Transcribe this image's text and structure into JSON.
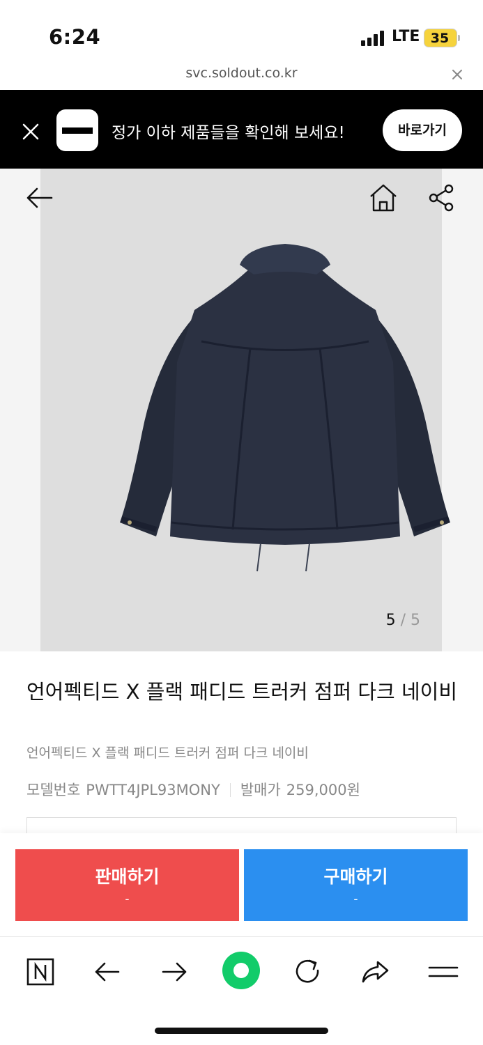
{
  "status_bar": {
    "time": "6:24",
    "network": "LTE",
    "battery": "35"
  },
  "url_bar": {
    "url": "svc.soldout.co.kr"
  },
  "banner": {
    "text": "정가 이하 제품들을 확인해 보세요!",
    "button": "바로가기"
  },
  "product": {
    "title": "언어펙티드 X 플랙 패디드 트러커 점퍼 다크 네이비",
    "subtitle": "언어펙티드 X 플랙 패디드 트러커 점퍼 다크 네이비",
    "image_index": {
      "current": "5",
      "separator": "/",
      "total": "5"
    },
    "model_label": "모델번호",
    "model_value": "PWTT4JPL93MONY",
    "price_label": "발매가",
    "price_value": "259,000원"
  },
  "actions": {
    "sell_label": "판매하기",
    "sell_price": "-",
    "buy_label": "구매하기",
    "buy_price": "-",
    "sell_color": "#ef4d4d",
    "buy_color": "#2b8ff0"
  },
  "toolbar_icons": [
    "naver-n-icon",
    "back-arrow-icon",
    "forward-arrow-icon",
    "green-dot-icon",
    "reload-icon",
    "share-icon",
    "menu-icon"
  ]
}
